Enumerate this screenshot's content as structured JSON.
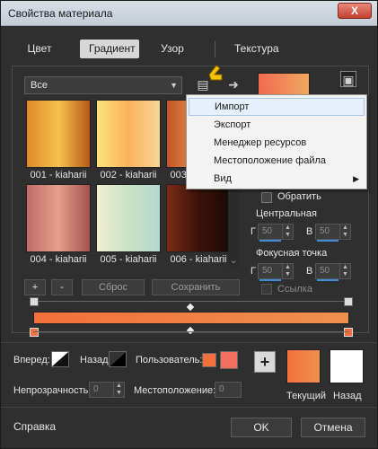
{
  "window": {
    "title": "Свойства материала",
    "close": "X"
  },
  "tabs": [
    "Цвет",
    "Градиент",
    "Узор",
    "Текстура"
  ],
  "dropdown": {
    "value": "Все"
  },
  "gradients": [
    {
      "label": "001 - kiaharii",
      "colors": [
        "#e0882c",
        "#f5c24d",
        "#b85a18"
      ]
    },
    {
      "label": "002 - kiaharii",
      "colors": [
        "#fce27c",
        "#fbb25a",
        "#f5d69a"
      ]
    },
    {
      "label": "003 - kiaharii",
      "colors": [
        "#c2542a",
        "#e7914c",
        "#9a3c1c"
      ]
    },
    {
      "label": "004 - kiaharii",
      "colors": [
        "#c46a6a",
        "#e2a08c",
        "#a85050"
      ]
    },
    {
      "label": "005 - kiaharii",
      "colors": [
        "#f3efd2",
        "#c7e2c4",
        "#b6d9d0"
      ]
    },
    {
      "label": "006 - kiaharii",
      "colors": [
        "#7a2a16",
        "#3c120a",
        "#1a0904"
      ]
    }
  ],
  "buttons": {
    "add": "+",
    "remove": "-",
    "reset": "Сброс",
    "save": "Сохранить"
  },
  "menu": {
    "items": [
      {
        "label": "Импорт",
        "hover": true
      },
      {
        "label": "Экспорт"
      },
      {
        "label": "Менеджер ресурсов"
      },
      {
        "label": "Местоположение файла"
      },
      {
        "label": "Вид",
        "submenu": "▶"
      }
    ]
  },
  "options": {
    "invert": "Обратить",
    "center_point": "Центральная",
    "focal_point": "Фокусная точка",
    "link": "Ссылка",
    "g_label": "Г",
    "v_label": "В",
    "center_g": "50",
    "center_v": "50",
    "focal_g": "50",
    "focal_v": "50"
  },
  "bottom": {
    "forward": "Вперед:",
    "backward": "Назад:",
    "user": "Пользователь:",
    "opacity_label": "Непрозрачность:",
    "opacity_value": "0",
    "location_label": "Местоположение:",
    "location_value": "0",
    "current": "Текущий",
    "previous": "Назад",
    "plus": "+"
  },
  "footer": {
    "help": "Справка",
    "ok": "OK",
    "cancel": "Отмена"
  },
  "colors": {
    "gradient_start": "#f2703c",
    "gradient_end": "#f09050",
    "accent": "#3a8fd8"
  }
}
